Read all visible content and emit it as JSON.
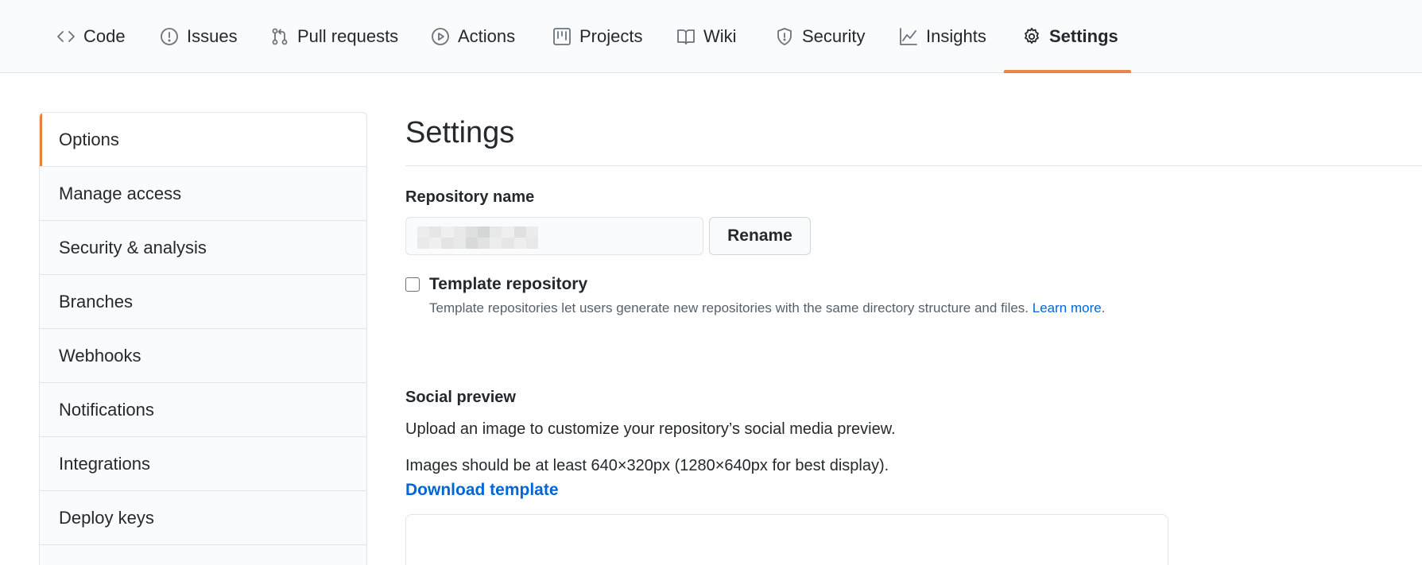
{
  "repo_nav": {
    "tabs": [
      {
        "label": "Code",
        "icon": "code-icon"
      },
      {
        "label": "Issues",
        "icon": "issue-icon"
      },
      {
        "label": "Pull requests",
        "icon": "pull-request-icon"
      },
      {
        "label": "Actions",
        "icon": "play-icon"
      },
      {
        "label": "Projects",
        "icon": "project-icon"
      },
      {
        "label": "Wiki",
        "icon": "book-icon"
      },
      {
        "label": "Security",
        "icon": "shield-icon"
      },
      {
        "label": "Insights",
        "icon": "graph-icon"
      },
      {
        "label": "Settings",
        "icon": "gear-icon",
        "active": true
      }
    ]
  },
  "sidebar": {
    "items": [
      {
        "label": "Options",
        "active": true
      },
      {
        "label": "Manage access"
      },
      {
        "label": "Security & analysis"
      },
      {
        "label": "Branches"
      },
      {
        "label": "Webhooks"
      },
      {
        "label": "Notifications"
      },
      {
        "label": "Integrations"
      },
      {
        "label": "Deploy keys"
      }
    ]
  },
  "main": {
    "title": "Settings",
    "repo_name_label": "Repository name",
    "repo_name_value": "",
    "rename_label": "Rename",
    "template": {
      "label": "Template repository",
      "checked": false,
      "description": "Template repositories let users generate new repositories with the same directory structure and files.",
      "learn_more": "Learn more",
      "period": "."
    },
    "social_preview": {
      "heading": "Social preview",
      "description": "Upload an image to customize your repository’s social media preview.",
      "size_note": "Images should be at least 640×320px (1280×640px for best display).",
      "download_label": "Download template"
    }
  },
  "colors": {
    "accent_underline": "#e36209",
    "link": "#0366d6",
    "border": "#e1e4e8",
    "nav_bg": "#fafbfc"
  }
}
